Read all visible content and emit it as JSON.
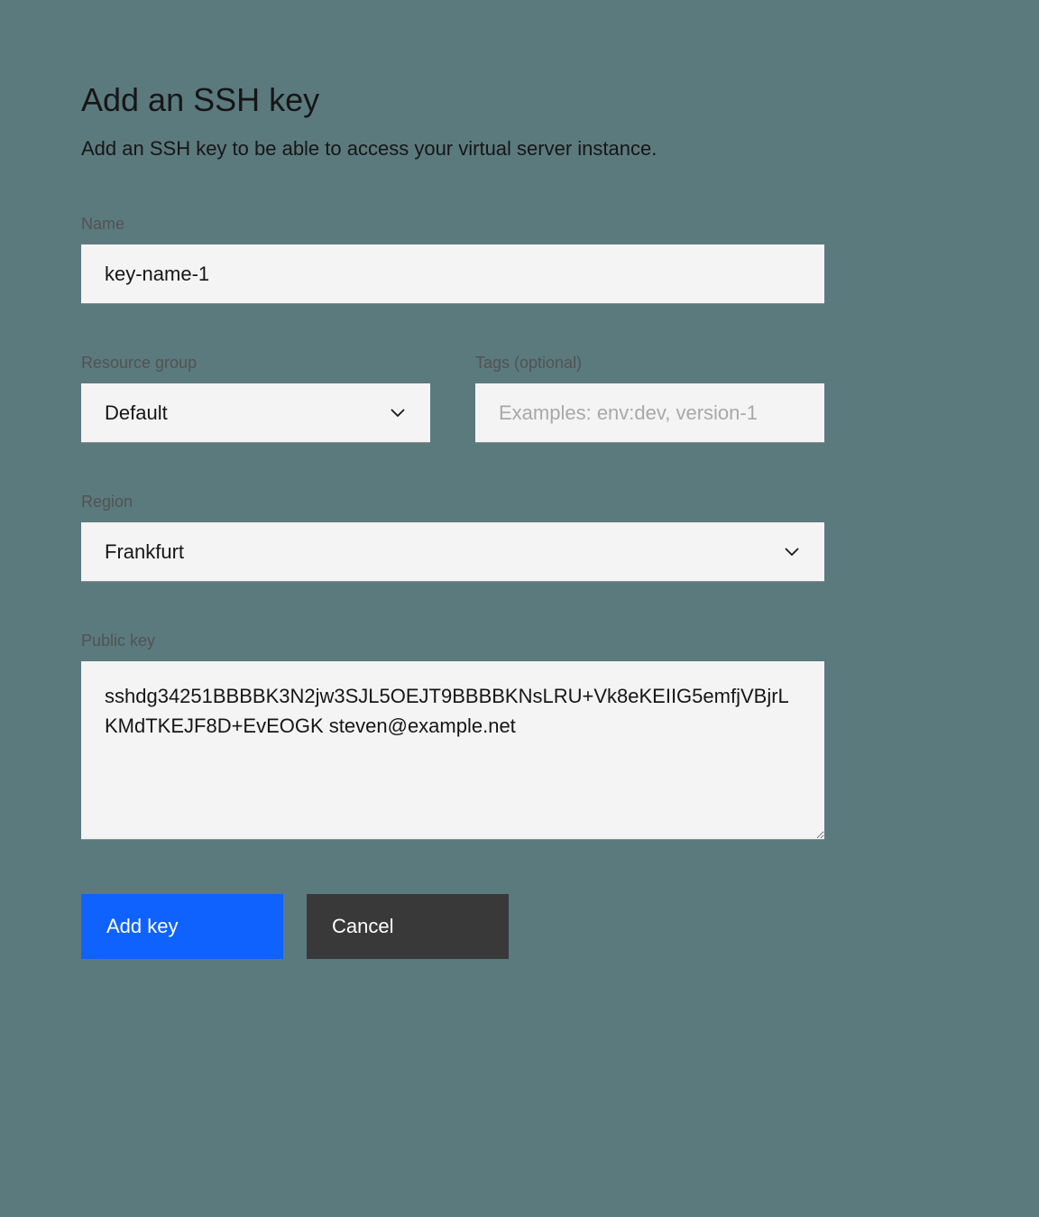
{
  "title": "Add an SSH key",
  "subtitle": "Add an SSH key to be able to access your virtual server instance.",
  "fields": {
    "name": {
      "label": "Name",
      "value": "key-name-1"
    },
    "resource_group": {
      "label": "Resource group",
      "value": "Default"
    },
    "tags": {
      "label": "Tags (optional)",
      "placeholder": "Examples: env:dev, version-1",
      "value": ""
    },
    "region": {
      "label": "Region",
      "value": "Frankfurt"
    },
    "public_key": {
      "label": "Public key",
      "value": "sshdg34251BBBBK3N2jw3SJL5OEJT9BBBBKNsLRU+Vk8eKEIIG5emfjVBjrLKMdTKEJF8D+EvEOGK steven@example.net"
    }
  },
  "buttons": {
    "add_key": "Add key",
    "cancel": "Cancel"
  }
}
